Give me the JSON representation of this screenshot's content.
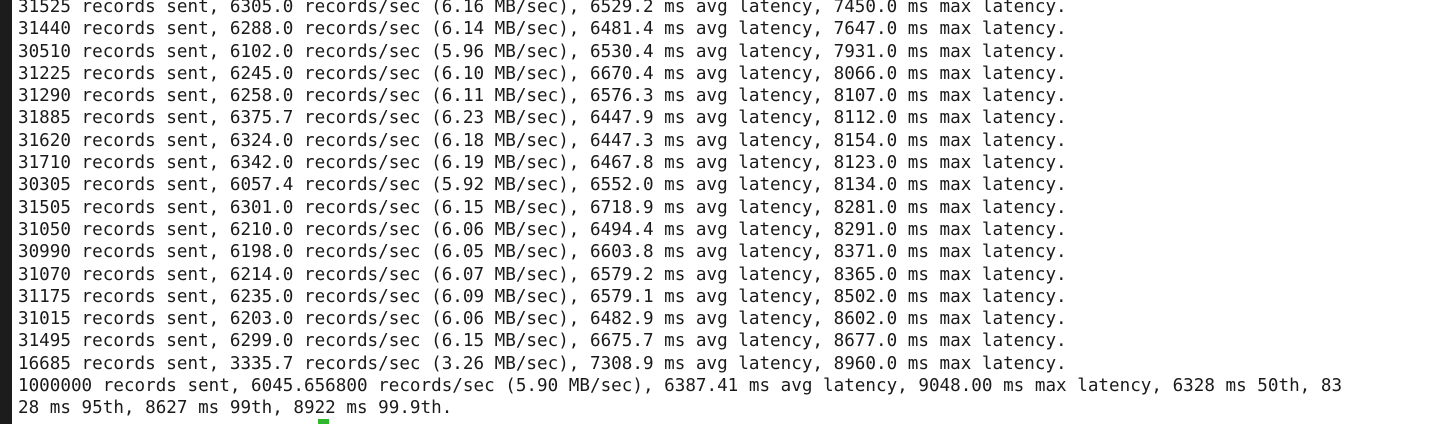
{
  "terminal": {
    "lines": [
      "31525 records sent, 6305.0 records/sec (6.16 MB/sec), 6529.2 ms avg latency, 7450.0 ms max latency.",
      "31440 records sent, 6288.0 records/sec (6.14 MB/sec), 6481.4 ms avg latency, 7647.0 ms max latency.",
      "30510 records sent, 6102.0 records/sec (5.96 MB/sec), 6530.4 ms avg latency, 7931.0 ms max latency.",
      "31225 records sent, 6245.0 records/sec (6.10 MB/sec), 6670.4 ms avg latency, 8066.0 ms max latency.",
      "31290 records sent, 6258.0 records/sec (6.11 MB/sec), 6576.3 ms avg latency, 8107.0 ms max latency.",
      "31885 records sent, 6375.7 records/sec (6.23 MB/sec), 6447.9 ms avg latency, 8112.0 ms max latency.",
      "31620 records sent, 6324.0 records/sec (6.18 MB/sec), 6447.3 ms avg latency, 8154.0 ms max latency.",
      "31710 records sent, 6342.0 records/sec (6.19 MB/sec), 6467.8 ms avg latency, 8123.0 ms max latency.",
      "30305 records sent, 6057.4 records/sec (5.92 MB/sec), 6552.0 ms avg latency, 8134.0 ms max latency.",
      "31505 records sent, 6301.0 records/sec (6.15 MB/sec), 6718.9 ms avg latency, 8281.0 ms max latency.",
      "31050 records sent, 6210.0 records/sec (6.06 MB/sec), 6494.4 ms avg latency, 8291.0 ms max latency.",
      "30990 records sent, 6198.0 records/sec (6.05 MB/sec), 6603.8 ms avg latency, 8371.0 ms max latency.",
      "31070 records sent, 6214.0 records/sec (6.07 MB/sec), 6579.2 ms avg latency, 8365.0 ms max latency.",
      "31175 records sent, 6235.0 records/sec (6.09 MB/sec), 6579.1 ms avg latency, 8502.0 ms max latency.",
      "31015 records sent, 6203.0 records/sec (6.06 MB/sec), 6482.9 ms avg latency, 8602.0 ms max latency.",
      "31495 records sent, 6299.0 records/sec (6.15 MB/sec), 6675.7 ms avg latency, 8677.0 ms max latency.",
      "16685 records sent, 3335.7 records/sec (3.26 MB/sec), 7308.9 ms avg latency, 8960.0 ms max latency.",
      "1000000 records sent, 6045.656800 records/sec (5.90 MB/sec), 6387.41 ms avg latency, 9048.00 ms max latency, 6328 ms 50th, 83",
      "28 ms 95th, 8627 ms 99th, 8922 ms 99.9th."
    ]
  },
  "colors": {
    "background": "#ffffff",
    "text": "#1a1a1a",
    "left_bar": "#1c1c1c",
    "cursor": "#2eb82e"
  }
}
